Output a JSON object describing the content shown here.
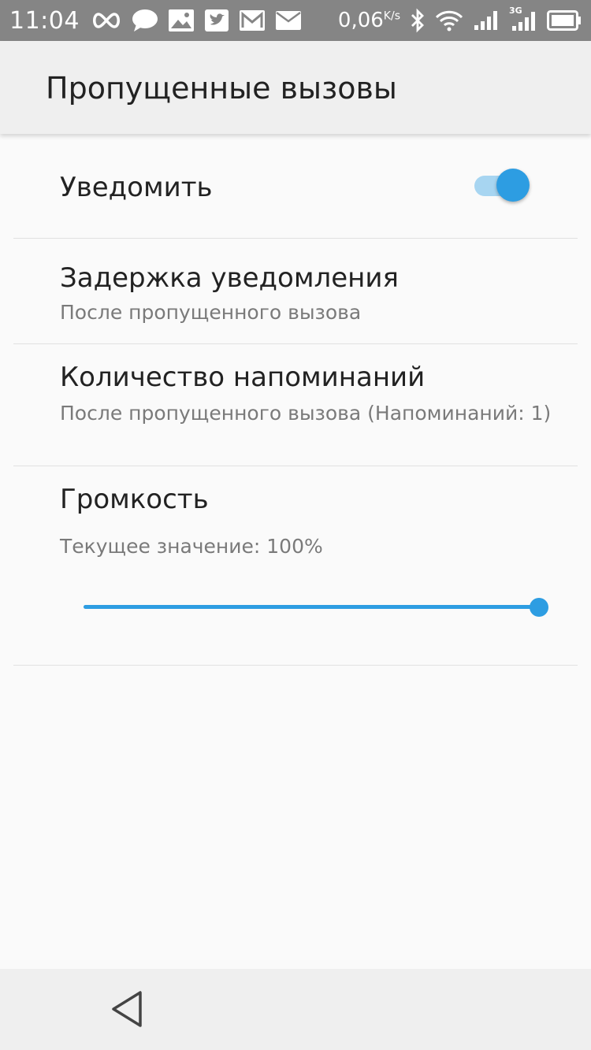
{
  "status_bar": {
    "time": "11:04",
    "speed_value": "0,06",
    "speed_unit": "K/s",
    "network_label": "3G",
    "color": "#858585"
  },
  "toolbar": {
    "title": "Пропущенные вызовы"
  },
  "preferences": {
    "notify": {
      "title": "Уведомить",
      "enabled": true
    },
    "delay": {
      "title": "Задержка уведомления",
      "summary": "После пропущенного вызова"
    },
    "reminders": {
      "title": "Количество напоминаний",
      "summary": "После пропущенного вызова (Напоминаний: 1)"
    },
    "volume": {
      "title": "Громкость",
      "summary": "Текущее значение: 100%",
      "value_percent": 100
    }
  },
  "colors": {
    "accent": "#2d9de2",
    "accent_light": "#a7d5f1",
    "toolbar_bg": "#efefef",
    "page_bg": "#fafafa"
  }
}
